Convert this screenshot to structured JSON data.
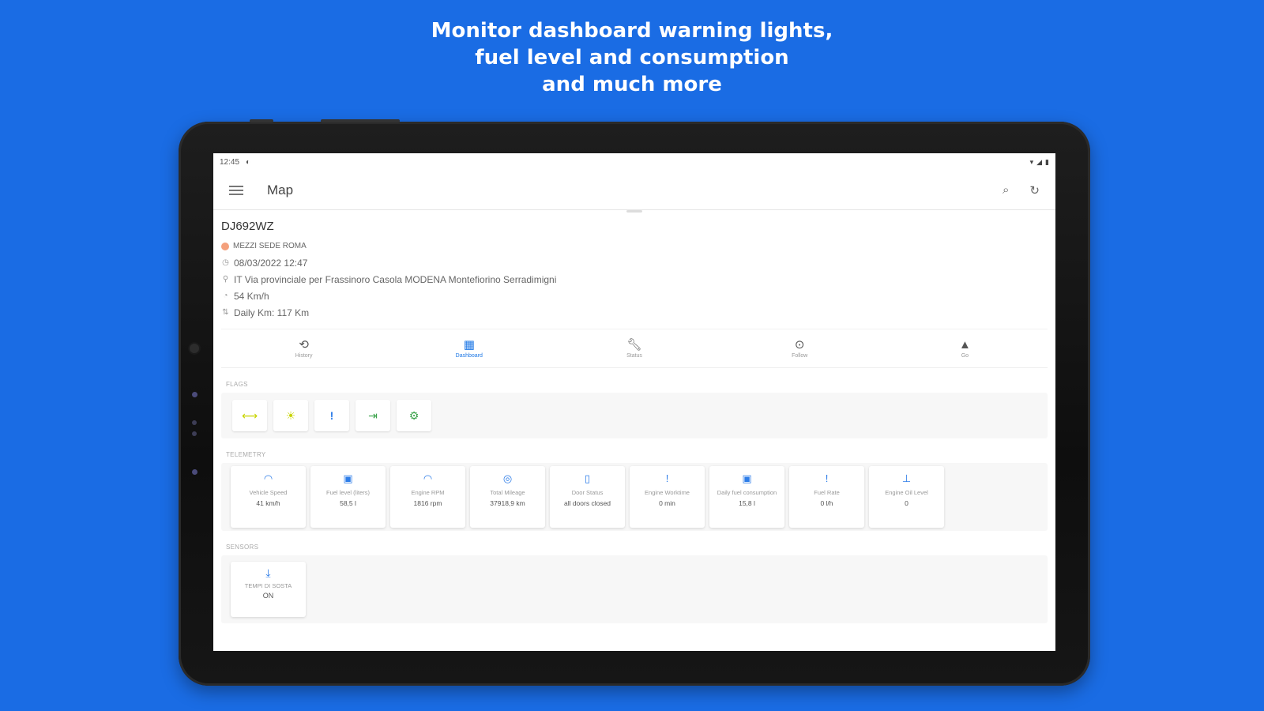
{
  "headline": {
    "line1": "Monitor dashboard warning lights,",
    "line2": "fuel level and consumption",
    "line3": "and much more"
  },
  "statusbar": {
    "time": "12:45"
  },
  "appbar": {
    "title": "Map"
  },
  "vehicle": {
    "plate": "DJ692WZ",
    "group": "MEZZI SEDE ROMA",
    "datetime": "08/03/2022 12:47",
    "address": "IT Via provinciale per Frassinoro Casola MODENA Montefiorino Serradimigni",
    "speed": "54 Km/h",
    "daily_km": "Daily Km: 117 Km"
  },
  "tabs": [
    {
      "label": "History",
      "icon": "history-icon"
    },
    {
      "label": "Dashboard",
      "icon": "dashboard-icon"
    },
    {
      "label": "Status",
      "icon": "wrench-icon"
    },
    {
      "label": "Follow",
      "icon": "follow-icon"
    },
    {
      "label": "Go",
      "icon": "navigation-icon"
    }
  ],
  "sections": {
    "flags": "FLAGS",
    "telemetry": "TELEMETRY",
    "sensors": "SENSORS"
  },
  "telemetry": [
    {
      "name": "Vehicle Speed",
      "value": "41 km/h"
    },
    {
      "name": "Fuel level (liters)",
      "value": "58,5 l"
    },
    {
      "name": "Engine RPM",
      "value": "1816 rpm"
    },
    {
      "name": "Total Mileage",
      "value": "37918,9 km"
    },
    {
      "name": "Door Status",
      "value": "all doors closed"
    },
    {
      "name": "Engine Worktime",
      "value": "0 min"
    },
    {
      "name": "Daily fuel consumption",
      "value": "15,8 l"
    },
    {
      "name": "Fuel Rate",
      "value": "0 l/h"
    },
    {
      "name": "Engine Oil Level",
      "value": "0"
    }
  ],
  "sensors": [
    {
      "name": "TEMPI DI SOSTA",
      "value": "ON"
    }
  ],
  "colors": {
    "background": "#1a6ce4",
    "accent": "#1e78e6"
  }
}
